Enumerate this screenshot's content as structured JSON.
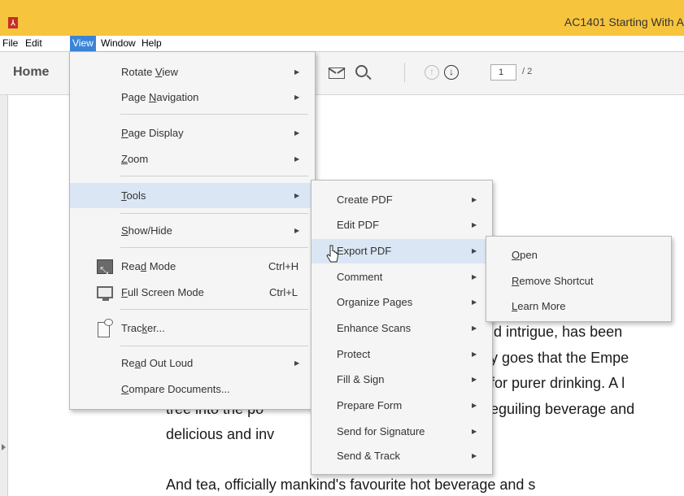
{
  "window": {
    "title": "AC1401 Starting With A"
  },
  "menubar": [
    "File",
    "Edit",
    "View",
    "Window",
    "Help"
  ],
  "toolbar": {
    "home_tab": "Home",
    "page_current": "1",
    "page_total": "/ 2"
  },
  "document": {
    "lines": [
      "id intrigue, has been",
      "y goes that the Empe",
      "for purer drinking. A l",
      "tree into the po",
      "eguiling beverage and",
      "delicious and inv",
      "And tea, officially mankind's favourite hot beverage and s"
    ]
  },
  "view_menu": {
    "rotate_view": [
      "Rotate ",
      "V",
      "iew"
    ],
    "page_navigation": [
      "Page ",
      "N",
      "avigation"
    ],
    "page_display": [
      "",
      "P",
      "age Display"
    ],
    "zoom": [
      "",
      "Z",
      "oom"
    ],
    "tools": [
      "",
      "T",
      "ools"
    ],
    "show_hide": [
      "",
      "S",
      "how/Hide"
    ],
    "read_mode": [
      "Rea",
      "d",
      " Mode"
    ],
    "read_mode_shortcut": "Ctrl+H",
    "full_screen": [
      "",
      "F",
      "ull Screen Mode"
    ],
    "full_screen_shortcut": "Ctrl+L",
    "tracker": [
      "Trac",
      "k",
      "er..."
    ],
    "read_out_loud": [
      "Re",
      "a",
      "d Out Loud"
    ],
    "compare_documents": [
      "",
      "C",
      "ompare Documents..."
    ]
  },
  "tools_menu": [
    "Create PDF",
    "Edit PDF",
    "Export PDF",
    "Comment",
    "Organize Pages",
    "Enhance Scans",
    "Protect",
    "Fill & Sign",
    "Prepare Form",
    "Send for Signature",
    "Send & Track"
  ],
  "export_menu": {
    "open": [
      "",
      "O",
      "pen"
    ],
    "remove_shortcut": [
      "",
      "R",
      "emove Shortcut"
    ],
    "learn_more": [
      "",
      "L",
      "earn More"
    ]
  },
  "colors": {
    "titlebar": "#f7c43e",
    "menubar_active": "#3b84d6",
    "menu_highlight": "#dbe6f4"
  }
}
